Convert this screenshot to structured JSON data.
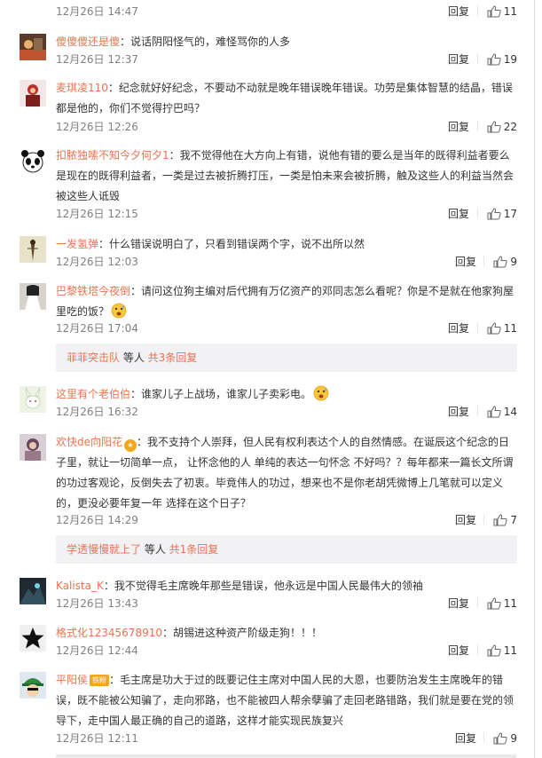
{
  "reply_label": "回复",
  "comments": [
    {
      "user": "",
      "text": "",
      "time": "12月26日 14:47",
      "likes": "11"
    },
    {
      "user": "傻傻傻还是傻",
      "text": "：说话阴阳怪气的，难怪骂你的人多",
      "time": "12月26日 12:37",
      "likes": "19"
    },
    {
      "user": "麦琪凌110",
      "text": "：纪念就好好纪念，不要动不动就是晚年错误晚年错误。功劳是集体智慧的结晶，错误都是他的，你们不觉得拧巴吗？",
      "time": "12月26日 12:26",
      "likes": "22"
    },
    {
      "user": "扣脓独嗦不知今夕何夕1",
      "text": "：我不觉得他在大方向上有错，说他有错的要么是当年的既得利益者要么是现在的既得利益者，一类是过去被折腾打压，一类是怕未来会被折腾，触及这些人的利益当然会被这些人诋毁",
      "time": "12月26日 12:15",
      "likes": "17"
    },
    {
      "user": "一发氢弹",
      "text": "：什么错误说明白了，只看到错误两个字，说不出所以然",
      "time": "12月26日 12:03",
      "likes": "9"
    },
    {
      "user": "巴黎铁塔今夜倒",
      "text": "：请问这位狗主编对后代拥有万亿资产的邓同志怎么看呢？你是不是就在他家狗屋里吃的饭？",
      "time": "12月26日 17:04",
      "likes": "11",
      "sub": {
        "user": "菲菲突击队",
        "mid": " 等人 ",
        "link": "共3条回复"
      }
    },
    {
      "user": "这里有个老伯伯",
      "text": "：谁家儿子上战场，谁家儿子卖彩电。",
      "time": "12月26日 16:32",
      "likes": "14"
    },
    {
      "user": "欢快de向阳花",
      "text": "：我不支持个人崇拜，但人民有权利表达个人的自然情感。在诞辰这个纪念的日子里，就让一切简单一点， 让怀念他的人 单纯的表达一句怀念 不好吗？？每年都来一篇长文所谓的功过客观论，反倒失去了初衷。毕竟伟人的功过，想来也不是你老胡凭微博上几笔就可以定义的，更没必要年复一年 选择在这个日子？",
      "time": "12月26日 14:29",
      "likes": "7",
      "sub": {
        "user": "学透慢慢就上了",
        "mid": " 等人 ",
        "link": "共1条回复"
      }
    },
    {
      "user": "Kalista_K",
      "text": "：我不觉得毛主席晚年那些是错误，他永远是中国人民最伟大的领袖",
      "time": "12月26日 13:43",
      "likes": "11"
    },
    {
      "user": "格式化12345678910",
      "text": "：胡锡进这种资产阶级走狗！！！",
      "time": "12月26日 12:44",
      "likes": "11"
    },
    {
      "user": "平阳侯",
      "fan": "铁粉",
      "text": "：毛主席是功大于过的既要记住主席对中国人民的大恩，也要防治发生主席晚年的错误，既不能被公知骗了，走向邪路，也不能被四人帮余孽骗了走回老路错路，我们就是要在党的领导下，走中国人最正确的自己的道路，这样才能实现民族复兴",
      "time": "12月26日 12:11",
      "likes": "9"
    }
  ]
}
